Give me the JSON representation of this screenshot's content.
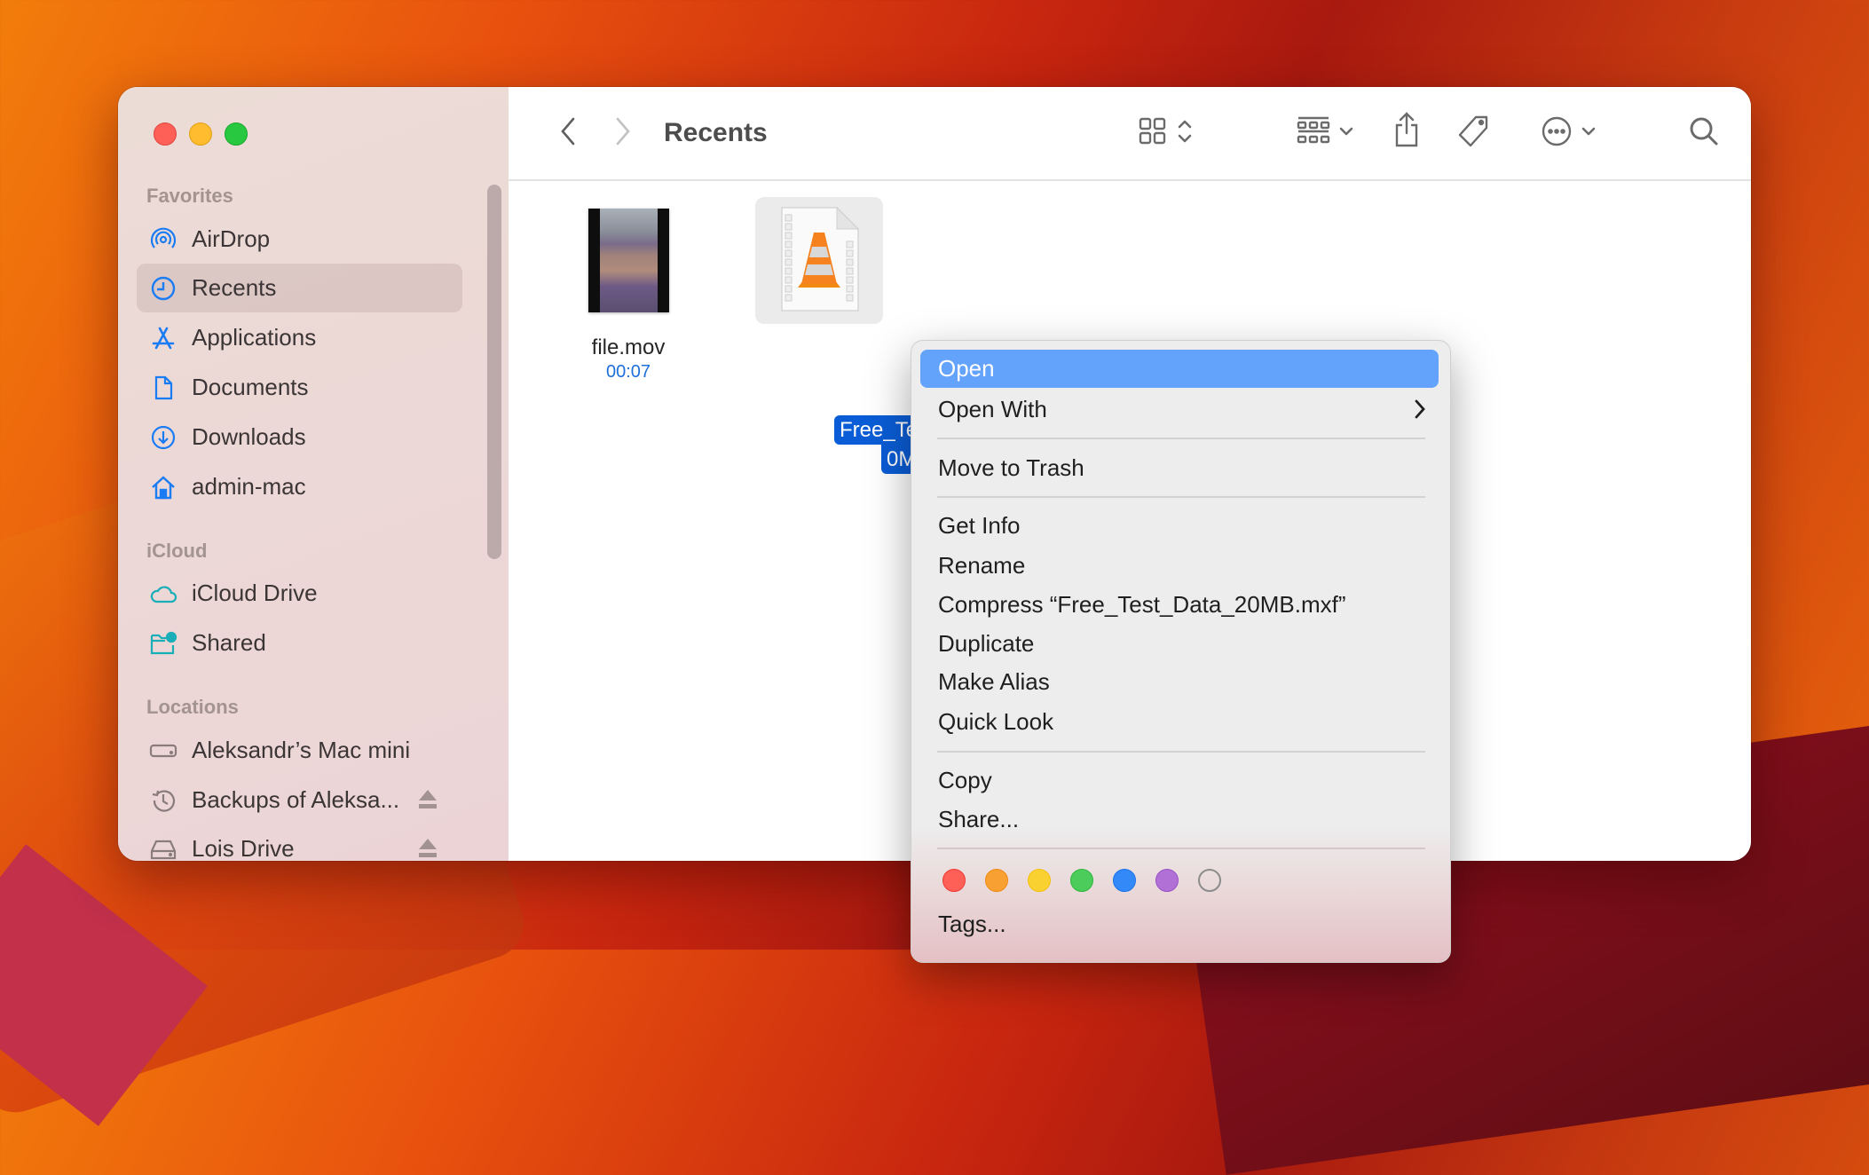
{
  "window": {
    "traffic_lights": [
      "close",
      "minimize",
      "zoom"
    ],
    "title": "Recents"
  },
  "toolbar": {
    "back_icon": "chevron-left-icon",
    "forward_icon": "chevron-right-icon",
    "view_icon": "icon-grid-view-icon",
    "group_icon": "group-by-icon",
    "share_icon": "share-icon",
    "tag_icon": "tag-icon",
    "more_icon": "ellipsis-circle-icon",
    "search_icon": "search-icon"
  },
  "sidebar": {
    "sections": [
      {
        "title": "Favorites",
        "items": [
          {
            "label": "AirDrop",
            "icon": "airdrop-icon"
          },
          {
            "label": "Recents",
            "icon": "clock-icon",
            "active": true
          },
          {
            "label": "Applications",
            "icon": "applications-icon"
          },
          {
            "label": "Documents",
            "icon": "document-icon"
          },
          {
            "label": "Downloads",
            "icon": "download-icon"
          },
          {
            "label": "admin-mac",
            "icon": "home-icon"
          }
        ]
      },
      {
        "title": "iCloud",
        "items": [
          {
            "label": "iCloud Drive",
            "icon": "cloud-icon"
          },
          {
            "label": "Shared",
            "icon": "shared-folder-icon"
          }
        ]
      },
      {
        "title": "Locations",
        "items": [
          {
            "label": "Aleksandr’s Mac mini",
            "icon": "computer-icon"
          },
          {
            "label": "Backups of Aleksa...",
            "icon": "time-machine-icon",
            "eject": true
          },
          {
            "label": "Lois Drive",
            "icon": "drive-icon",
            "eject": true
          }
        ]
      }
    ]
  },
  "files": [
    {
      "name": "file.mov",
      "meta": "00:07",
      "selected": false
    },
    {
      "name_line1": "Free_Test_Data_2",
      "name_line2": "0MB.mxf",
      "selected": true
    }
  ],
  "context_menu": {
    "items": [
      {
        "label": "Open",
        "highlighted": true
      },
      {
        "label": "Open With",
        "submenu": true
      },
      {
        "label": "Move to Trash"
      },
      {
        "label": "Get Info"
      },
      {
        "label": "Rename"
      },
      {
        "label": "Compress “Free_Test_Data_20MB.mxf”"
      },
      {
        "label": "Duplicate"
      },
      {
        "label": "Make Alias"
      },
      {
        "label": "Quick Look"
      },
      {
        "label": "Copy"
      },
      {
        "label": "Share..."
      },
      {
        "label": "Tags..."
      }
    ],
    "tag_colors": [
      {
        "name": "Red",
        "color": "#fe5f57"
      },
      {
        "name": "Orange",
        "color": "#f9a033"
      },
      {
        "name": "Yellow",
        "color": "#f9d232"
      },
      {
        "name": "Green",
        "color": "#4ccc5a"
      },
      {
        "name": "Blue",
        "color": "#3489f9"
      },
      {
        "name": "Purple",
        "color": "#b070d6"
      },
      {
        "name": "Gray",
        "color": "none"
      }
    ]
  },
  "colors": {
    "accent": "#0a5dd6",
    "menu_highlight": "#63a3fb",
    "sidebar_icon": "#1a7cf5",
    "icloud_icon": "#1aaeb8"
  }
}
